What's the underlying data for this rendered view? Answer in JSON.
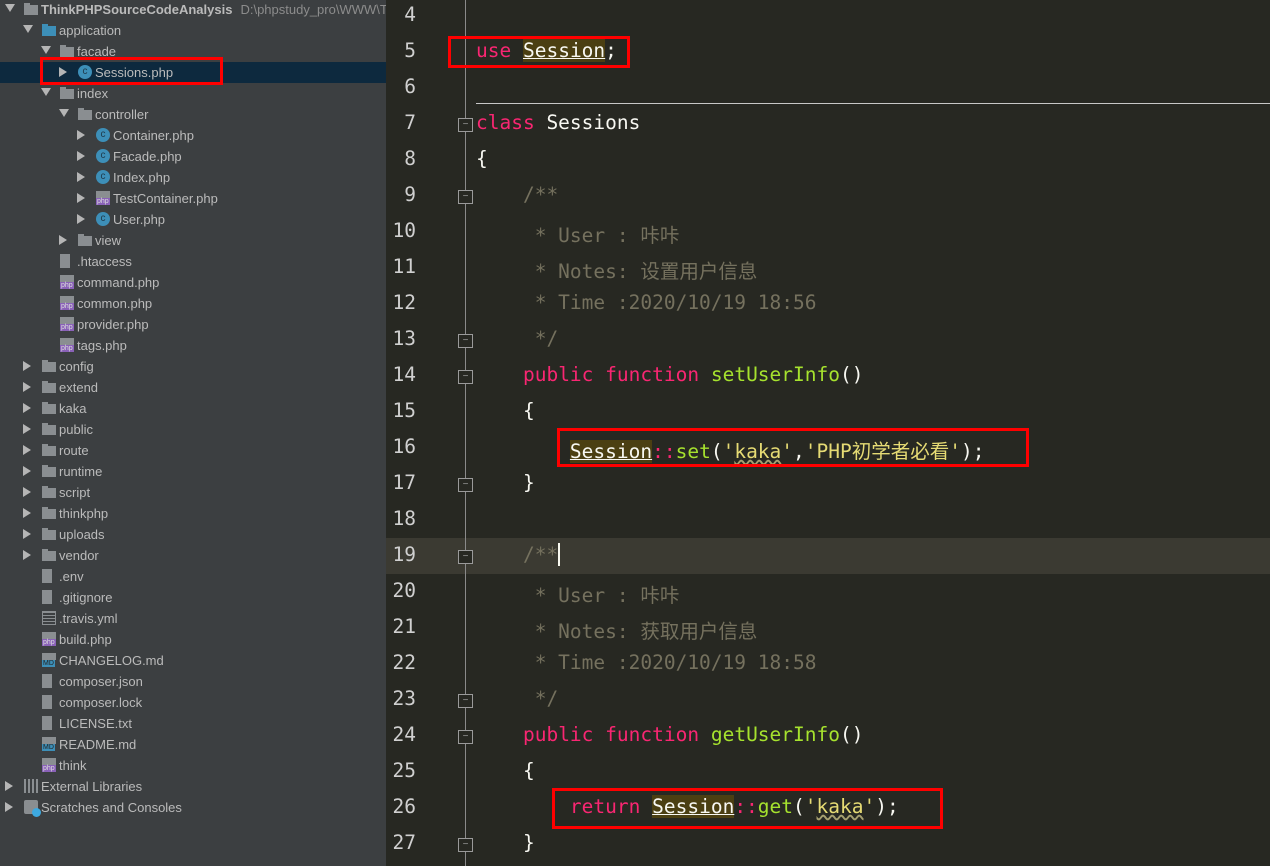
{
  "project_tree": {
    "items": [
      {
        "label": "ThinkPHPSourceCodeAnalysis",
        "path": "D:\\phpstudy_pro\\WWW\\Th",
        "level": 0,
        "arrow": "down",
        "icon": "folder-icon",
        "bold": true
      },
      {
        "label": "application",
        "level": 1,
        "arrow": "down",
        "icon": "folder-blue-icon"
      },
      {
        "label": "facade",
        "level": 2,
        "arrow": "down",
        "icon": "folder-icon"
      },
      {
        "label": "Sessions.php",
        "level": 3,
        "arrow": "right",
        "icon": "class-icon",
        "selected": true
      },
      {
        "label": "index",
        "level": 2,
        "arrow": "down",
        "icon": "folder-icon"
      },
      {
        "label": "controller",
        "level": 3,
        "arrow": "down",
        "icon": "folder-icon"
      },
      {
        "label": "Container.php",
        "level": 4,
        "arrow": "right",
        "icon": "class-icon"
      },
      {
        "label": "Facade.php",
        "level": 4,
        "arrow": "right",
        "icon": "class-icon"
      },
      {
        "label": "Index.php",
        "level": 4,
        "arrow": "right",
        "icon": "class-icon"
      },
      {
        "label": "TestContainer.php",
        "level": 4,
        "arrow": "right",
        "icon": "php-file-icon"
      },
      {
        "label": "User.php",
        "level": 4,
        "arrow": "right",
        "icon": "class-icon"
      },
      {
        "label": "view",
        "level": 3,
        "arrow": "right",
        "icon": "folder-icon"
      },
      {
        "label": ".htaccess",
        "level": 2,
        "icon": "text-file-icon"
      },
      {
        "label": "command.php",
        "level": 2,
        "icon": "php-file-icon"
      },
      {
        "label": "common.php",
        "level": 2,
        "icon": "php-file-icon"
      },
      {
        "label": "provider.php",
        "level": 2,
        "icon": "php-file-icon"
      },
      {
        "label": "tags.php",
        "level": 2,
        "icon": "php-file-icon"
      },
      {
        "label": "config",
        "level": 1,
        "arrow": "right",
        "icon": "folder-icon"
      },
      {
        "label": "extend",
        "level": 1,
        "arrow": "right",
        "icon": "folder-icon"
      },
      {
        "label": "kaka",
        "level": 1,
        "arrow": "right",
        "icon": "folder-icon"
      },
      {
        "label": "public",
        "level": 1,
        "arrow": "right",
        "icon": "folder-icon"
      },
      {
        "label": "route",
        "level": 1,
        "arrow": "right",
        "icon": "folder-icon"
      },
      {
        "label": "runtime",
        "level": 1,
        "arrow": "right",
        "icon": "folder-icon"
      },
      {
        "label": "script",
        "level": 1,
        "arrow": "right",
        "icon": "folder-icon"
      },
      {
        "label": "thinkphp",
        "level": 1,
        "arrow": "right",
        "icon": "folder-icon"
      },
      {
        "label": "uploads",
        "level": 1,
        "arrow": "right",
        "icon": "folder-icon"
      },
      {
        "label": "vendor",
        "level": 1,
        "arrow": "right",
        "icon": "folder-icon"
      },
      {
        "label": ".env",
        "level": 1,
        "icon": "text-file-icon"
      },
      {
        "label": ".gitignore",
        "level": 1,
        "icon": "text-file-icon"
      },
      {
        "label": ".travis.yml",
        "level": 1,
        "icon": "yaml-file-icon"
      },
      {
        "label": "build.php",
        "level": 1,
        "icon": "php-file-icon"
      },
      {
        "label": "CHANGELOG.md",
        "level": 1,
        "icon": "markdown-file-icon"
      },
      {
        "label": "composer.json",
        "level": 1,
        "icon": "json-file-icon"
      },
      {
        "label": "composer.lock",
        "level": 1,
        "icon": "json-file-icon"
      },
      {
        "label": "LICENSE.txt",
        "level": 1,
        "icon": "text-file-icon"
      },
      {
        "label": "README.md",
        "level": 1,
        "icon": "markdown-file-icon"
      },
      {
        "label": "think",
        "level": 1,
        "icon": "php-file-icon"
      },
      {
        "label": "External Libraries",
        "level": 0,
        "arrow": "right",
        "icon": "libraries-icon"
      },
      {
        "label": "Scratches and Consoles",
        "level": 0,
        "arrow": "right",
        "icon": "scratches-icon"
      }
    ]
  },
  "editor": {
    "current_line": 19,
    "lines": [
      {
        "n": "4",
        "t": []
      },
      {
        "n": "5",
        "t": [
          [
            "kw",
            "use"
          ],
          [
            "",
            " "
          ],
          [
            "cn",
            "Session"
          ],
          [
            "",
            ";"
          ]
        ]
      },
      {
        "n": "6",
        "t": []
      },
      {
        "n": "7",
        "t": [
          [
            "kw",
            "class"
          ],
          [
            "",
            " Sessions"
          ]
        ]
      },
      {
        "n": "8",
        "t": [
          [
            "",
            "{"
          ]
        ]
      },
      {
        "n": "9",
        "t": [
          [
            "cm",
            "    /**"
          ]
        ]
      },
      {
        "n": "10",
        "t": [
          [
            "cm",
            "     * User : 咔咔"
          ]
        ]
      },
      {
        "n": "11",
        "t": [
          [
            "cm",
            "     * Notes: 设置用户信息"
          ]
        ]
      },
      {
        "n": "12",
        "t": [
          [
            "cm",
            "     * Time :2020/10/19 18:56"
          ]
        ]
      },
      {
        "n": "13",
        "t": [
          [
            "cm",
            "     */"
          ]
        ]
      },
      {
        "n": "14",
        "t": [
          [
            "",
            "    "
          ],
          [
            "kw",
            "public"
          ],
          [
            "",
            " "
          ],
          [
            "kw",
            "function"
          ],
          [
            "",
            " "
          ],
          [
            "fn",
            "setUserInfo"
          ],
          [
            "",
            "()"
          ]
        ]
      },
      {
        "n": "15",
        "t": [
          [
            "",
            "    {"
          ]
        ]
      },
      {
        "n": "16",
        "t": [
          [
            "",
            "        "
          ],
          [
            "cn",
            "Session"
          ],
          [
            "op",
            "::"
          ],
          [
            "fn",
            "set"
          ],
          [
            "",
            "("
          ],
          [
            "st",
            "'"
          ],
          [
            "st wavy",
            "kaka"
          ],
          [
            "st",
            "'"
          ],
          [
            "",
            ","
          ],
          [
            "st",
            "'PHP初学者必看'"
          ],
          [
            "",
            ");"
          ]
        ]
      },
      {
        "n": "17",
        "t": [
          [
            "",
            "    }"
          ]
        ]
      },
      {
        "n": "18",
        "t": []
      },
      {
        "n": "19",
        "t": [
          [
            "cm",
            "    /**"
          ],
          [
            "caret",
            ""
          ]
        ]
      },
      {
        "n": "20",
        "t": [
          [
            "cm",
            "     * User : 咔咔"
          ]
        ]
      },
      {
        "n": "21",
        "t": [
          [
            "cm",
            "     * Notes: 获取用户信息"
          ]
        ]
      },
      {
        "n": "22",
        "t": [
          [
            "cm",
            "     * Time :2020/10/19 18:58"
          ]
        ]
      },
      {
        "n": "23",
        "t": [
          [
            "cm",
            "     */"
          ]
        ]
      },
      {
        "n": "24",
        "t": [
          [
            "",
            "    "
          ],
          [
            "kw",
            "public"
          ],
          [
            "",
            " "
          ],
          [
            "kw",
            "function"
          ],
          [
            "",
            " "
          ],
          [
            "fn",
            "getUserInfo"
          ],
          [
            "",
            "()"
          ]
        ]
      },
      {
        "n": "25",
        "t": [
          [
            "",
            "    {"
          ]
        ]
      },
      {
        "n": "26",
        "t": [
          [
            "",
            "        "
          ],
          [
            "kw",
            "return"
          ],
          [
            "",
            " "
          ],
          [
            "cn",
            "Session"
          ],
          [
            "op",
            "::"
          ],
          [
            "fn",
            "get"
          ],
          [
            "",
            "("
          ],
          [
            "st",
            "'"
          ],
          [
            "st wavy",
            "kaka"
          ],
          [
            "st",
            "'"
          ],
          [
            "",
            ");"
          ]
        ]
      },
      {
        "n": "27",
        "t": [
          [
            "",
            "    }"
          ]
        ]
      }
    ]
  },
  "colors": {
    "highlight_box": "#ff0000",
    "keyword": "#f92672",
    "function": "#a6e22e",
    "comment": "#75715e",
    "string": "#e6db74",
    "background": "#272822",
    "sidebar": "#3c3f41"
  }
}
